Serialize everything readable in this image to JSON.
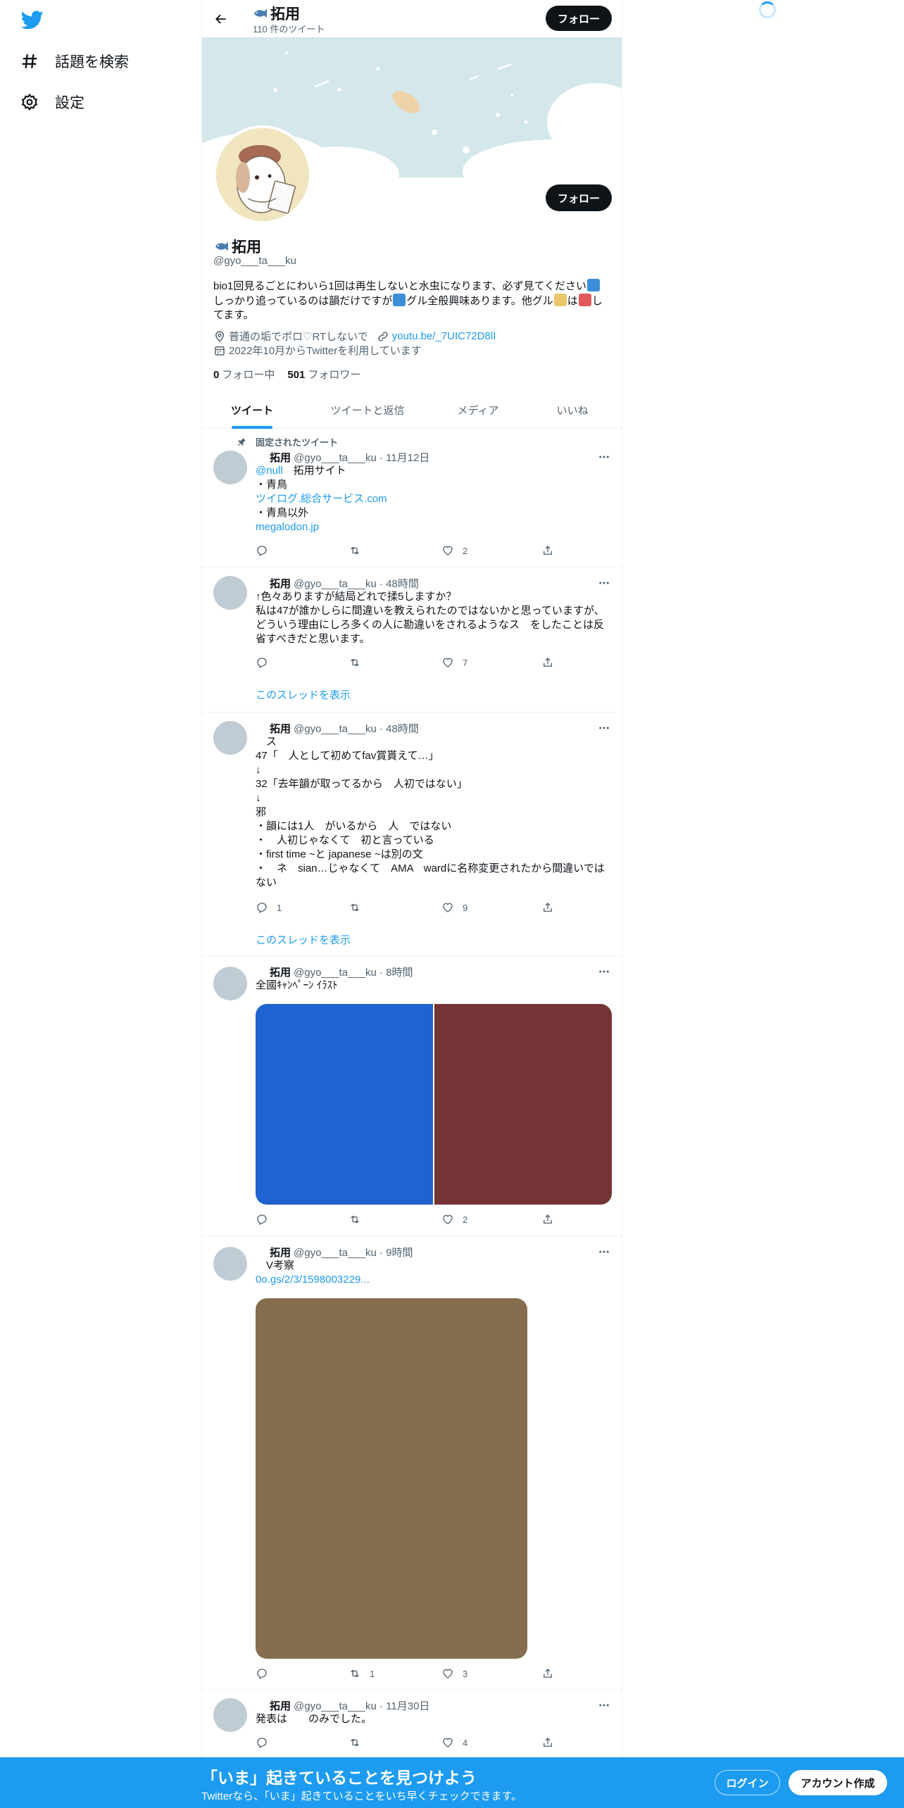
{
  "sidebar": {
    "explore_label": "話題を検索",
    "settings_label": "設定"
  },
  "header": {
    "name": "拓用",
    "tweet_count": "110 件のツイート",
    "follow_label": "フォロー"
  },
  "profile": {
    "name": "拓用",
    "handle": "@gyo___ta___ku",
    "follow_label": "フォロー",
    "bio_line1": "bio1回見るごとにわいら1回は再生しないと水虫になります、必ず見てください",
    "bio_line2a": "しっかり追っているのは韻だけですが",
    "bio_line2b": "グル全般興味あります。他グル",
    "bio_line2c": "は",
    "bio_line2d": "し",
    "bio_line3": "てます。",
    "location": "普通の垢でポロ♡RTしないで",
    "link": "youtu.be/_7UIC72D8lI",
    "joined": "2022年10月からTwitterを利用しています",
    "following_count": "0",
    "following_label": "フォロー中",
    "followers_count": "501",
    "followers_label": "フォロワー"
  },
  "tabs": [
    {
      "label": "ツイート"
    },
    {
      "label": "ツイートと返信"
    },
    {
      "label": "メディア"
    },
    {
      "label": "いいね"
    }
  ],
  "tweets": [
    {
      "pinned_label": "固定されたツイート",
      "name": "拓用",
      "meta": "@gyo___ta___ku · 11月12日",
      "mention": "@null",
      "text1": "　拓用サイト",
      "text2": "・青鳥",
      "link1": "ツイログ.総合サービス.com",
      "text3": "・青鳥以外",
      "link2": "megalodon.jp",
      "replies": "",
      "retweets": "",
      "likes": "2"
    },
    {
      "name": "拓用",
      "meta": "@gyo___ta___ku · 48時間",
      "text": "↑色々ありますが結局どれで揉5しますか？\n私は47が誰かしらに間違いを教えられたのではないかと思っていますが、どういう理由にしろ多くの人に勘違いをされるようなス　をしたことは反省すべきだと思います。",
      "replies": "",
      "retweets": "",
      "likes": "7",
      "show_thread": "このスレッドを表示"
    },
    {
      "name": "拓用",
      "meta": "@gyo___ta___ku · 48時間",
      "text": "　ス\n47「　人として初めてfav賞貰えて…」\n↓\n32「去年韻が取ってるから　人初ではない」\n↓\n邪\n・韻には1人　がいるから　人　ではない\n・　人初じゃなくて　初と言っている\n・first time ~と japanese ~は別の文\n・　ネ　sian…じゃなくて　AMA　wardに名称変更されたから間違いではない",
      "replies": "1",
      "retweets": "",
      "likes": "9",
      "show_thread": "このスレッドを表示"
    },
    {
      "name": "拓用",
      "meta": "@gyo___ta___ku · 8時間",
      "text": "全國ｷｬﾝﾍﾟｰﾝ ｲﾗｽﾄ",
      "media_colors": [
        "#2062cf",
        "#743334"
      ],
      "replies": "",
      "retweets": "",
      "likes": "2"
    },
    {
      "name": "拓用",
      "meta": "@gyo___ta___ku · 9時間",
      "text": "　V考察",
      "link": "0o.gs/2/3/1598003229...",
      "media_color": "#856d4d",
      "replies": "",
      "retweets": "1",
      "likes": "3"
    },
    {
      "name": "拓用",
      "meta": "@gyo___ta___ku · 11月30日",
      "text": "発表は　　のみでした。",
      "replies": "",
      "retweets": "",
      "likes": "4"
    }
  ],
  "bottom_bar": {
    "title": "「いま」起きていることを見つけよう",
    "subtitle": "Twitterなら、「いま」起きていることをいち早くチェックできます。",
    "login_label": "ログイン",
    "signup_label": "アカウント作成"
  },
  "colors": {
    "accent": "#1d9bf0",
    "text": "#0f1419",
    "muted": "#536471"
  }
}
